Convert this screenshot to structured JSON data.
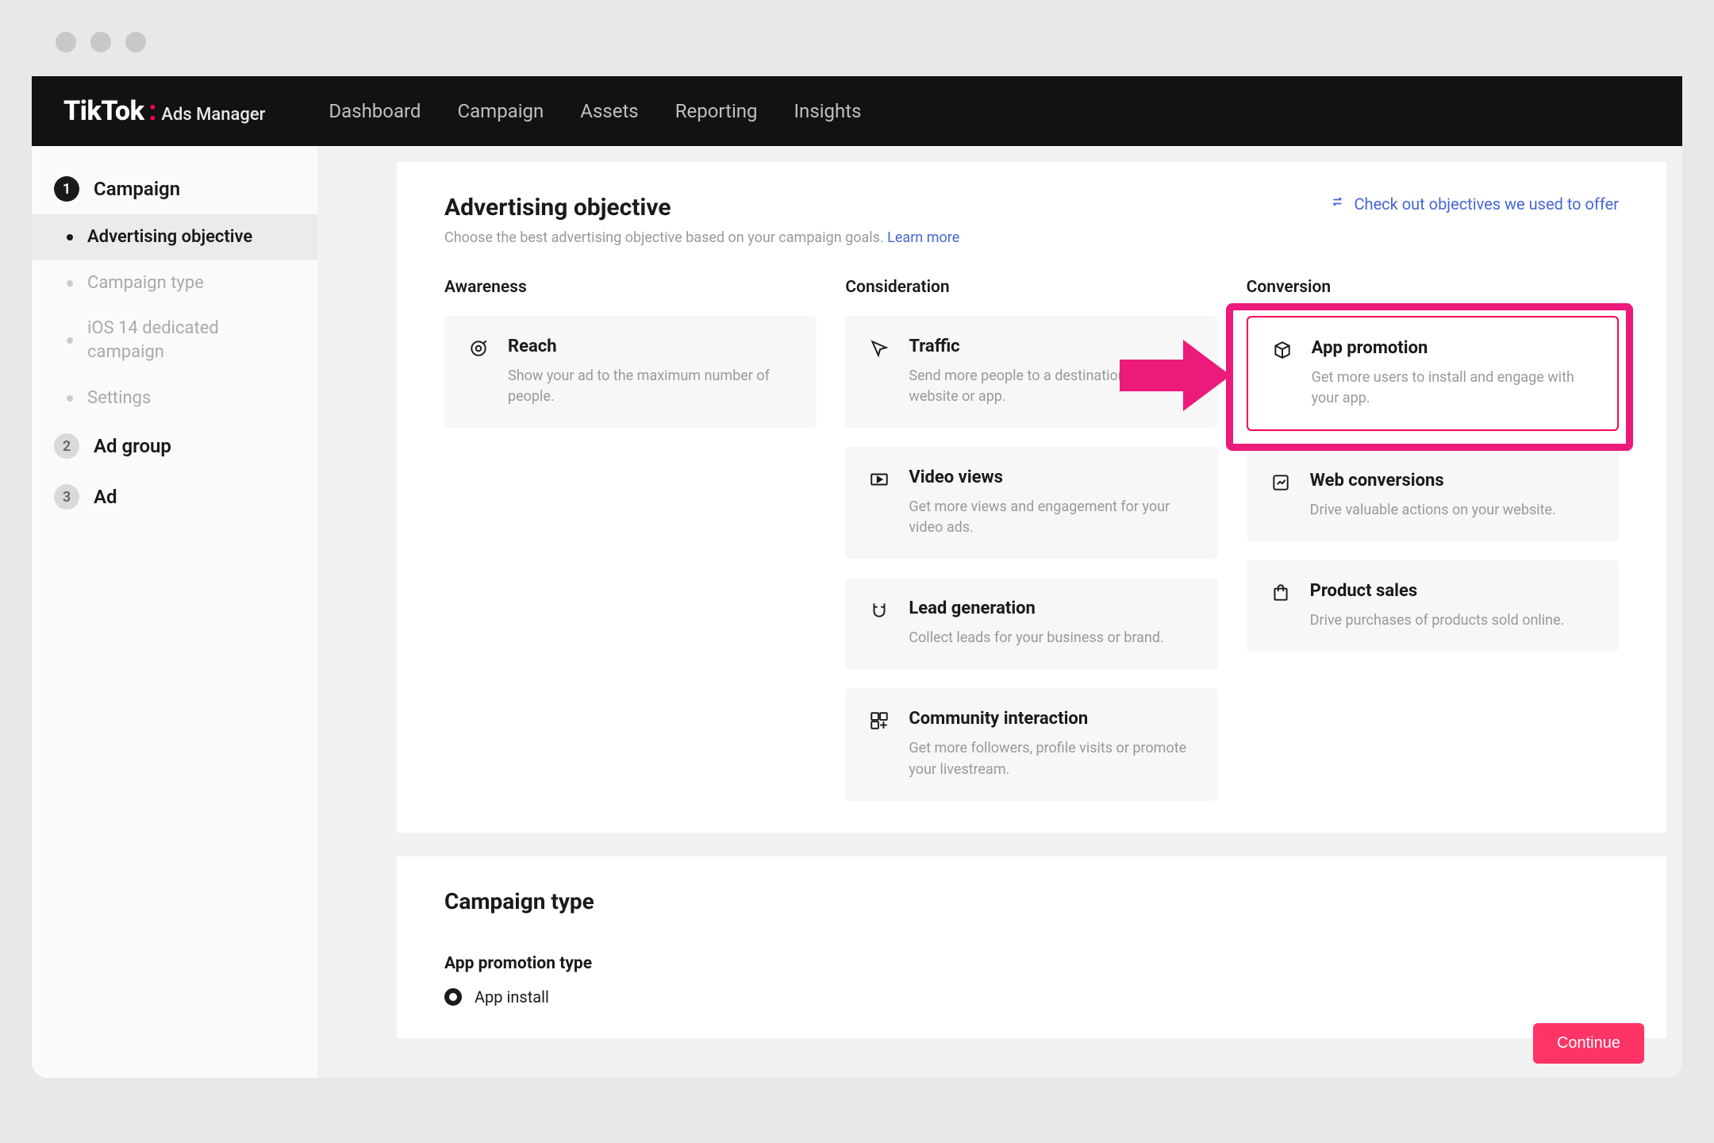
{
  "brand": {
    "logo": "TikTok",
    "sub": "Ads Manager"
  },
  "nav": {
    "dashboard": "Dashboard",
    "campaign": "Campaign",
    "assets": "Assets",
    "reporting": "Reporting",
    "insights": "Insights"
  },
  "sidebar": {
    "step1": "Campaign",
    "step2": "Ad group",
    "step3": "Ad",
    "subs": {
      "obj": "Advertising objective",
      "type": "Campaign type",
      "ios": "iOS 14 dedicated campaign",
      "settings": "Settings"
    }
  },
  "head": {
    "title": "Advertising objective",
    "sub": "Choose the best advertising objective based on your campaign goals.",
    "learn": "Learn more",
    "offer": "Check out objectives we used to offer"
  },
  "columns": {
    "awareness": "Awareness",
    "consideration": "Consideration",
    "conversion": "Conversion"
  },
  "cards": {
    "reach": {
      "title": "Reach",
      "desc": "Show your ad to the maximum number of people."
    },
    "traffic": {
      "title": "Traffic",
      "desc": "Send more people to a destination on your website or app."
    },
    "video": {
      "title": "Video views",
      "desc": "Get more views and engagement for your video ads."
    },
    "lead": {
      "title": "Lead generation",
      "desc": "Collect leads for your business or brand."
    },
    "community": {
      "title": "Community interaction",
      "desc": "Get more followers, profile visits or promote your livestream."
    },
    "app": {
      "title": "App promotion",
      "desc": "Get more users to install and engage with your app."
    },
    "web": {
      "title": "Web conversions",
      "desc": "Drive valuable actions on your website."
    },
    "sales": {
      "title": "Product sales",
      "desc": "Drive purchases of products sold online."
    }
  },
  "campaign_type": {
    "title": "Campaign type",
    "label": "App promotion type",
    "radio": "App install"
  },
  "footer": {
    "continue": "Continue"
  }
}
